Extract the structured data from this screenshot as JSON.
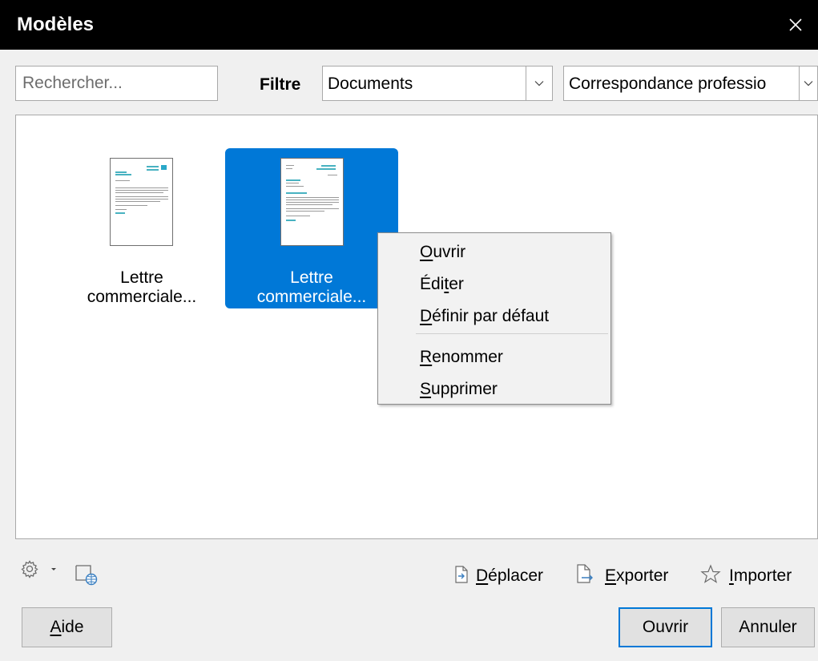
{
  "window": {
    "title": "Modèles"
  },
  "search": {
    "placeholder": "Rechercher..."
  },
  "filter": {
    "label": "Filtre",
    "type_value": "Documents",
    "category_value": "Correspondance professio"
  },
  "templates": [
    {
      "label_line1": "Lettre",
      "label_line2": "commerciale..."
    },
    {
      "label_line1": "Lettre",
      "label_line2": "commerciale..."
    }
  ],
  "context_menu": {
    "open": {
      "pre": "",
      "ul": "O",
      "post": "uvrir"
    },
    "edit": {
      "pre": "Édi",
      "ul": "t",
      "post": "er"
    },
    "set_default": {
      "pre": "",
      "ul": "D",
      "post": "éfinir par défaut"
    },
    "rename": {
      "pre": "",
      "ul": "R",
      "post": "enommer"
    },
    "delete": {
      "pre": "",
      "ul": "S",
      "post": "upprimer"
    }
  },
  "actions": {
    "move": {
      "ul": "D",
      "post": "éplacer"
    },
    "export": {
      "ul": "E",
      "post": "xporter"
    },
    "import": {
      "ul": "I",
      "post": "mporter"
    }
  },
  "buttons": {
    "help": {
      "ul": "A",
      "post": "ide"
    },
    "open": "Ouvrir",
    "cancel": "Annuler"
  },
  "icons": {
    "close": "close-icon",
    "settings": "gear-icon",
    "online": "online-repository-icon",
    "move": "move-icon",
    "export": "export-icon",
    "import": "star-icon"
  },
  "colors": {
    "accent": "#0078d7",
    "titlebar": "#000000"
  }
}
